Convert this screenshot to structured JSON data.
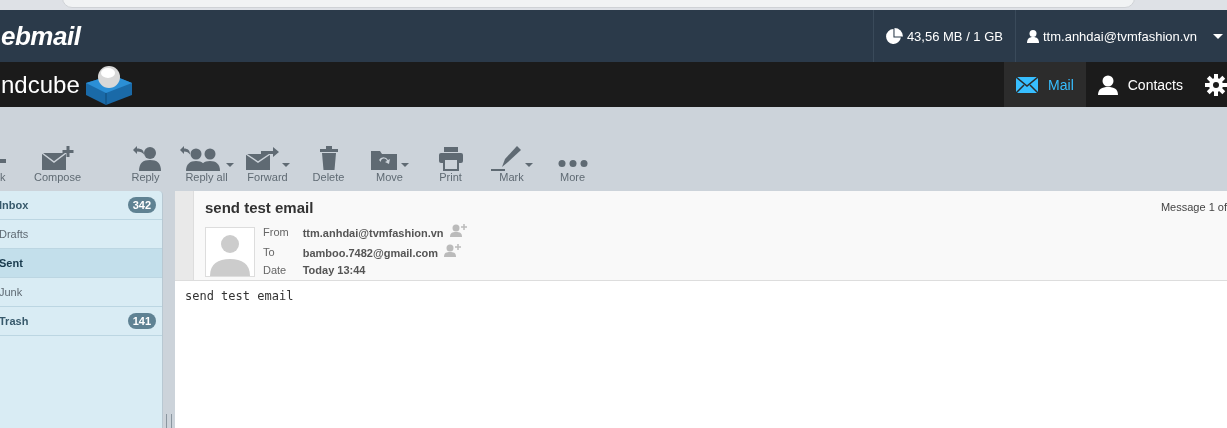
{
  "header": {
    "logo": "ebmail",
    "quota": "43,56 MB / 1 GB",
    "user": "ttm.anhdai@tvmfashion.vn"
  },
  "brand": {
    "logo": "ndcube"
  },
  "nav": [
    {
      "label": "Mail",
      "kind": "mail",
      "selected": true
    },
    {
      "label": "Contacts",
      "kind": "contacts",
      "selected": false
    },
    {
      "kind": "settings",
      "selected": false
    }
  ],
  "toolbar_left": [
    {
      "label": "k",
      "kind": "back",
      "dropdown": false
    },
    {
      "label": "Compose",
      "kind": "compose",
      "dropdown": false
    }
  ],
  "toolbar_message": [
    {
      "label": "Reply",
      "kind": "reply",
      "dropdown": false
    },
    {
      "label": "Reply all",
      "kind": "replyall",
      "dropdown": true
    },
    {
      "label": "Forward",
      "kind": "forward",
      "dropdown": true
    },
    {
      "label": "Delete",
      "kind": "delete",
      "dropdown": false
    },
    {
      "label": "Move",
      "kind": "move",
      "dropdown": true
    },
    {
      "label": "Print",
      "kind": "print",
      "dropdown": false
    },
    {
      "label": "Mark",
      "kind": "mark",
      "dropdown": true
    },
    {
      "label": "More",
      "kind": "more",
      "dropdown": false
    }
  ],
  "folders": [
    {
      "name": "Inbox",
      "count": "342",
      "selected": false
    },
    {
      "name": "Drafts",
      "selected": false
    },
    {
      "name": "Sent",
      "selected": true
    },
    {
      "name": "Junk",
      "selected": false
    },
    {
      "name": "Trash",
      "count": "141",
      "selected": false
    }
  ],
  "message": {
    "subject": "send test email",
    "counter": "Message 1 of",
    "fields": [
      {
        "label": "From",
        "value": "ttm.anhdai@tvmfashion.vn",
        "add_contact": true
      },
      {
        "label": "To",
        "value": "bamboo.7482@gmail.com",
        "add_contact": true
      },
      {
        "label": "Date",
        "value": "Today 13:44",
        "add_contact": false
      }
    ],
    "body": "send test email"
  }
}
